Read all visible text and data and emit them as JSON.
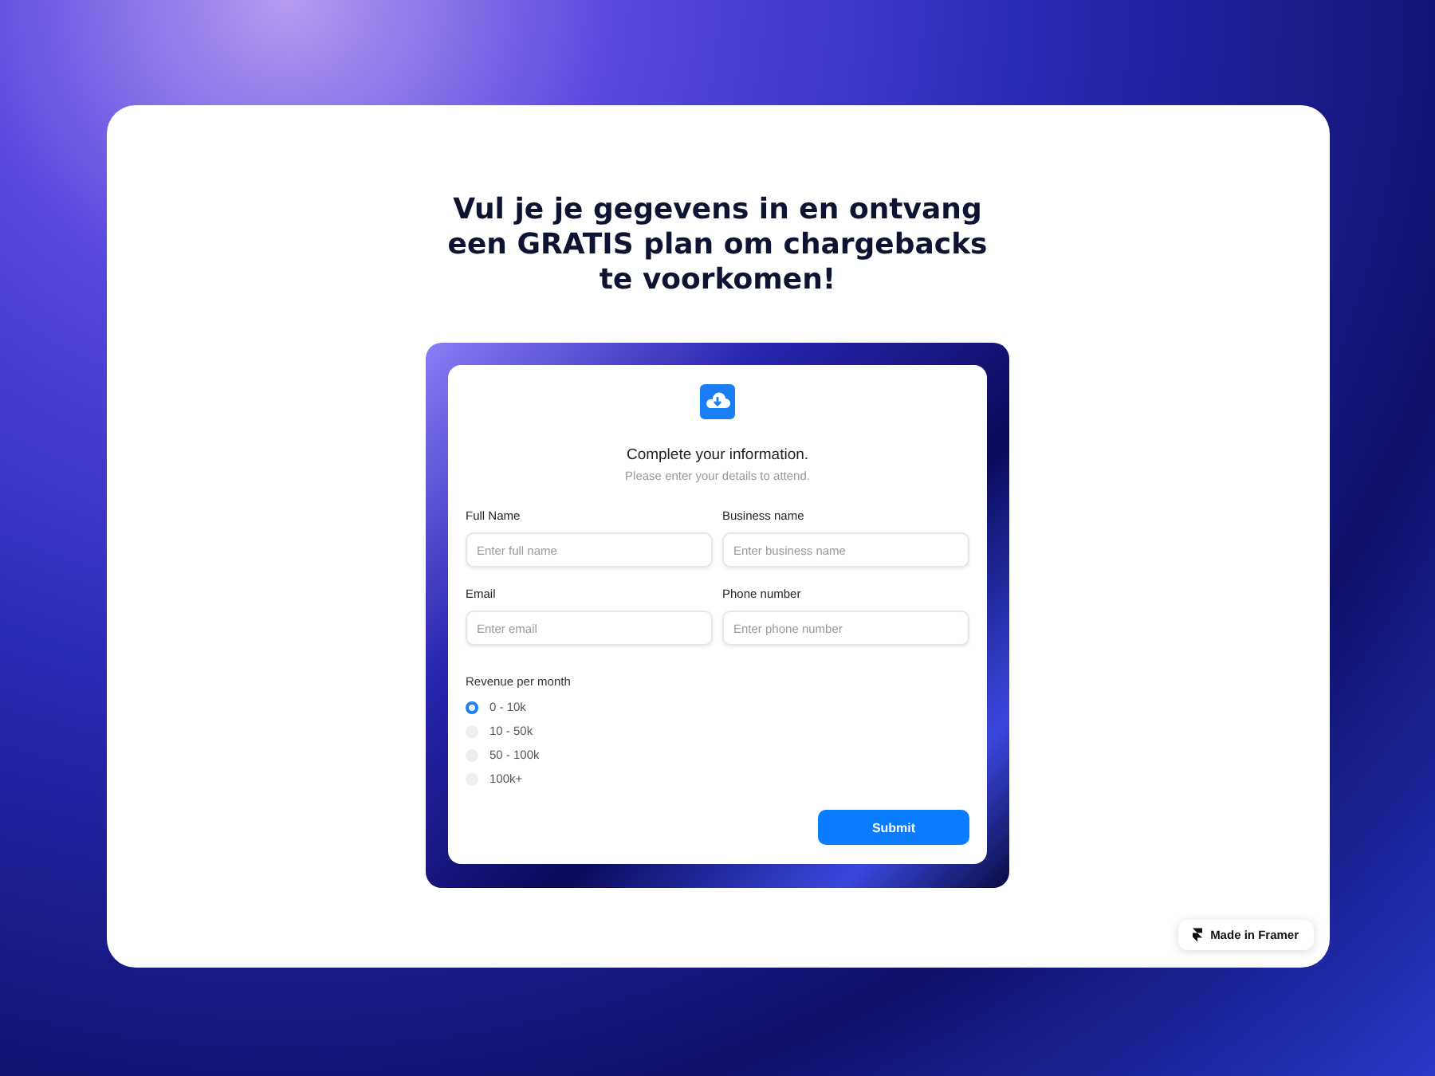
{
  "heading": "Vul je je gegevens in en ontvang een GRATIS plan om chargebacks te voorkomen!",
  "form": {
    "title": "Complete your information.",
    "subtitle": "Please enter your details to attend.",
    "fields": [
      {
        "label": "Full Name",
        "placeholder": "Enter full name"
      },
      {
        "label": "Business name",
        "placeholder": "Enter business name"
      },
      {
        "label": "Email",
        "placeholder": "Enter email"
      },
      {
        "label": "Phone number",
        "placeholder": "Enter phone number"
      }
    ],
    "radio_group": {
      "label": "Revenue per month",
      "options": [
        {
          "label": "0 - 10k",
          "selected": true
        },
        {
          "label": "10 - 50k",
          "selected": false
        },
        {
          "label": "50 - 100k",
          "selected": false
        },
        {
          "label": "100k+",
          "selected": false
        }
      ]
    },
    "submit": "Submit"
  },
  "badge": "Made in Framer"
}
